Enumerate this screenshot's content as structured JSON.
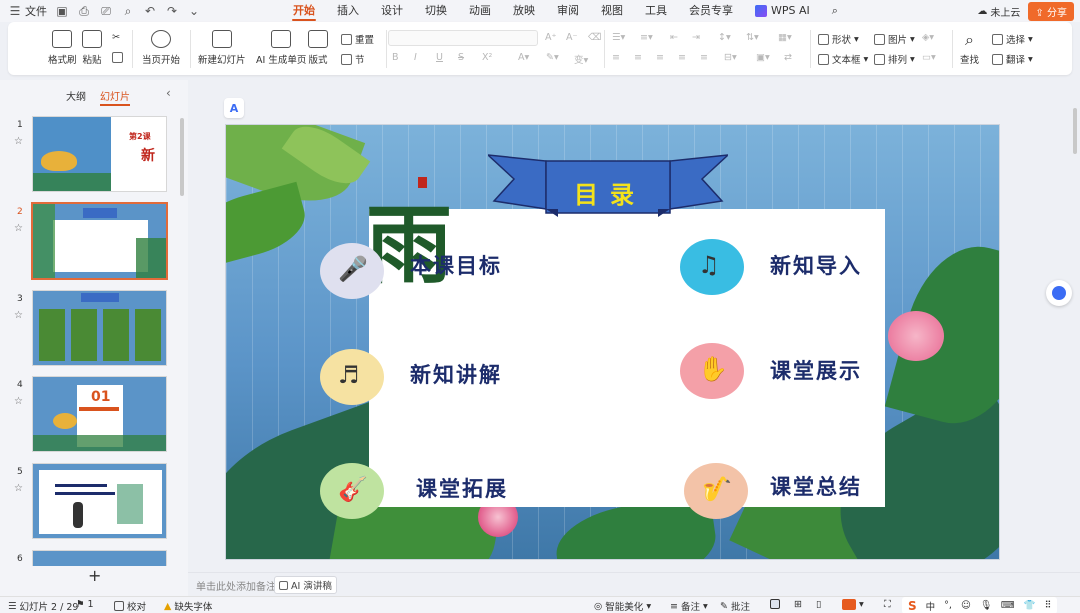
{
  "titlebar": {
    "file_label": "文件",
    "menus": [
      {
        "label": "开始",
        "active": true
      },
      {
        "label": "插入"
      },
      {
        "label": "设计"
      },
      {
        "label": "切换"
      },
      {
        "label": "动画"
      },
      {
        "label": "放映"
      },
      {
        "label": "审阅"
      },
      {
        "label": "视图"
      },
      {
        "label": "工具"
      },
      {
        "label": "会员专享"
      }
    ],
    "wps_ai_label": "WPS AI",
    "cloud_label": "未上云",
    "share_label": "分享"
  },
  "ribbon": {
    "format_painter": "格式刷",
    "paste": "粘贴",
    "start_from_current": "当页开始",
    "new_slide": "新建幻灯片",
    "ai_single_page": "AI 生成单页",
    "layout": "版式",
    "reset": "重置",
    "section": "节",
    "shape": "形状",
    "picture": "图片",
    "textbox": "文本框",
    "arrange": "排列",
    "find": "查找",
    "select": "选择",
    "translate": "翻译",
    "bold": "B",
    "italic": "I",
    "underline": "U",
    "strike": "S"
  },
  "left_panel": {
    "tab_outline": "大纲",
    "tab_slides": "幻灯片",
    "slide_numbers": [
      "1",
      "2",
      "3",
      "4",
      "5",
      "6"
    ],
    "selected_index": 1,
    "thumb1_title": "第2课",
    "thumb4_num": "01"
  },
  "slide": {
    "title": "目录",
    "calligraphy": "雨",
    "items": [
      {
        "label": "本课目标"
      },
      {
        "label": "新知导入"
      },
      {
        "label": "新知讲解"
      },
      {
        "label": "课堂展示"
      },
      {
        "label": "课堂拓展"
      },
      {
        "label": "课堂总结"
      }
    ]
  },
  "notes": {
    "placeholder": "单击此处添加备注",
    "ai_button": "AI 演讲稿"
  },
  "statusbar": {
    "slide_info": "幻灯片 2 / 29",
    "comments_count": "1",
    "proofread": "校对",
    "missing_font": "缺失字体",
    "smart_beautify": "智能美化",
    "notes": "备注",
    "annotate": "批注",
    "ime_lang": "中"
  },
  "colors": {
    "accent": "#d9531e",
    "share": "#f06a2a",
    "slide_text": "#1c2c6b",
    "banner": "#3a6bc4",
    "banner_text": "#f3e21b"
  }
}
